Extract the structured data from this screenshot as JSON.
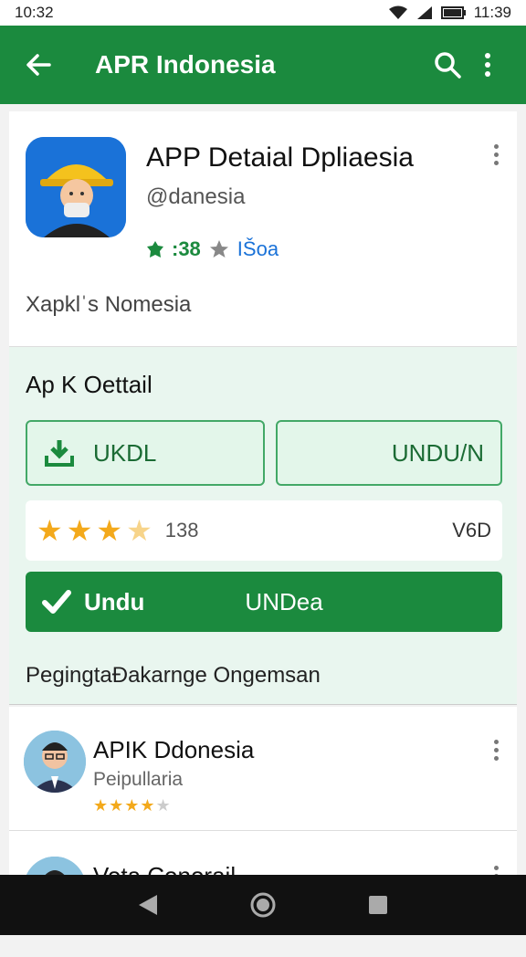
{
  "status": {
    "time_left": "10:32",
    "time_right": "11:39"
  },
  "appbar": {
    "title": "APR Indonesia",
    "back_icon": "back-arrow-icon",
    "search_icon": "search-icon",
    "menu_icon": "more-vert-icon"
  },
  "app": {
    "title": "APP Detaial  Dpliaesia",
    "developer": "@danesia",
    "rating_prefix": ":38",
    "rating_suffix": "IŠoa",
    "description": "Xapklˈs Nomesia"
  },
  "detail": {
    "section_title": "Ap K Oettail",
    "download_button_label": "UKDL",
    "unduh_button_label": "UNDU/N",
    "rating_count": "138",
    "size_label": "V6D",
    "install_icon_label": "Undu",
    "install_button_label": "UNDea",
    "package_text": "PegingtaĐakarnge Ongemsan"
  },
  "list": [
    {
      "title": "APIK Ddonesia",
      "subtitle": "Peipullaria",
      "stars": 4
    },
    {
      "title": "Vota Conorail",
      "subtitle": "",
      "stars": 0
    }
  ],
  "colors": {
    "primary": "#1b8a3e",
    "star": "#f3a91b",
    "accent_blue": "#1a72d8"
  }
}
